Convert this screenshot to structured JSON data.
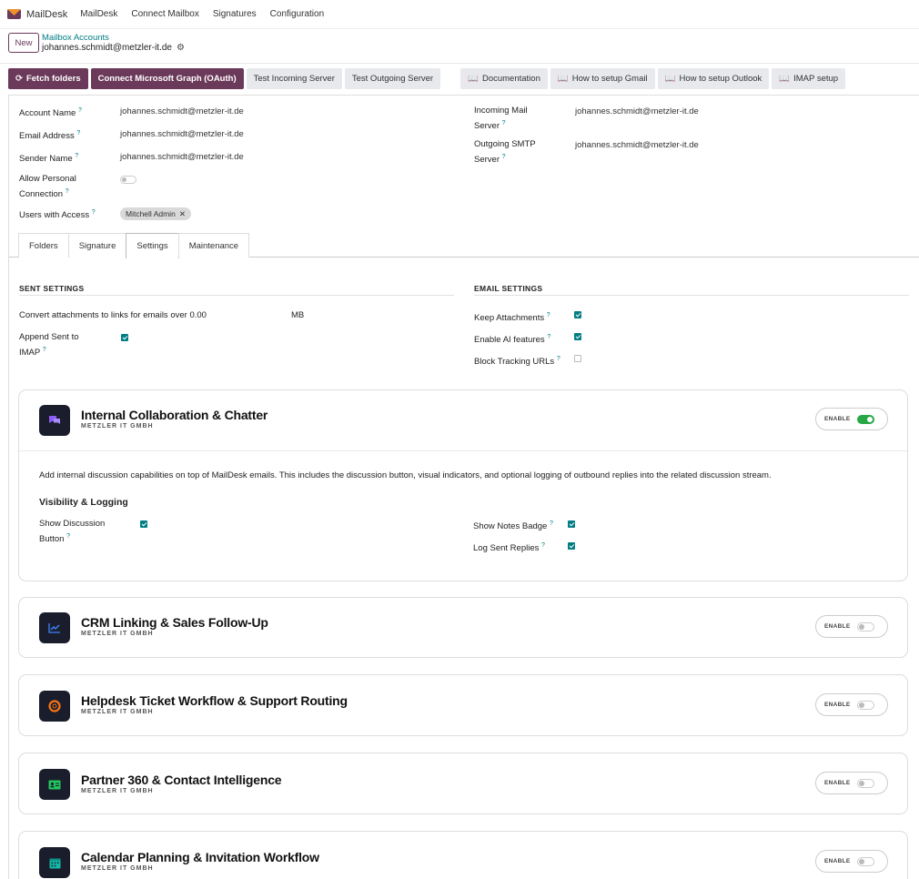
{
  "app": {
    "brand": "MailDesk",
    "accent": "#6b3a5a",
    "link_color": "#017e84"
  },
  "nav": [
    "MailDesk",
    "Connect Mailbox",
    "Signatures",
    "Configuration"
  ],
  "control": {
    "new_label": "New",
    "breadcrumb_parent": "Mailbox Accounts",
    "record_name": "johannes.schmidt@metzler-it.de"
  },
  "buttons": {
    "fetch": "Fetch folders",
    "connect_graph": "Connect Microsoft Graph (OAuth)",
    "test_incoming": "Test Incoming Server",
    "test_outgoing": "Test Outgoing Server",
    "documentation": "Documentation",
    "setup_gmail": "How to setup Gmail",
    "setup_outlook": "How to setup Outlook",
    "imap_setup": "IMAP setup"
  },
  "form": {
    "account_name": {
      "label": "Account Name",
      "value": "johannes.schmidt@metzler-it.de"
    },
    "email_address": {
      "label": "Email Address",
      "value": "johannes.schmidt@metzler-it.de"
    },
    "sender_name": {
      "label": "Sender Name",
      "value": "johannes.schmidt@metzler-it.de"
    },
    "allow_personal": {
      "label_1": "Allow Personal",
      "label_2": "Connection",
      "value": false
    },
    "users_access": {
      "label": "Users with Access",
      "tags": [
        "Mitchell Admin"
      ]
    },
    "incoming": {
      "label_1": "Incoming Mail",
      "label_2": "Server",
      "value": "johannes.schmidt@metzler-it.de"
    },
    "outgoing": {
      "label_1": "Outgoing SMTP",
      "label_2": "Server",
      "value": "johannes.schmidt@metzler-it.de"
    }
  },
  "tabs": [
    "Folders",
    "Signature",
    "Settings",
    "Maintenance"
  ],
  "active_tab": "Settings",
  "sent_settings": {
    "title": "SENT SETTINGS",
    "convert_label": "Convert attachments to links for emails over",
    "convert_value": "0.00",
    "convert_unit": "MB",
    "append_label_1": "Append Sent to",
    "append_label_2": "IMAP",
    "append_value": true
  },
  "email_settings": {
    "title": "EMAIL SETTINGS",
    "keep_attachments": {
      "label": "Keep Attachments",
      "value": true
    },
    "enable_ai": {
      "label": "Enable AI features",
      "value": true
    },
    "block_tracking": {
      "label": "Block Tracking URLs",
      "value": false
    }
  },
  "modules": [
    {
      "title": "Internal Collaboration & Chatter",
      "subtitle": "METZLER IT GMBH",
      "enable_label": "ENABLE",
      "enabled": true,
      "icon": "chat-icon",
      "icon_color": "#8b5cf6",
      "description": "Add internal discussion capabilities on top of MailDesk emails. This includes the discussion button, visual indicators, and optional logging of outbound replies into the related discussion stream.",
      "group_title": "Visibility & Logging",
      "show_discussion": {
        "label_1": "Show Discussion",
        "label_2": "Button",
        "value": true
      },
      "show_notes_badge": {
        "label": "Show Notes Badge",
        "value": true
      },
      "log_sent_replies": {
        "label": "Log Sent Replies",
        "value": true
      }
    },
    {
      "title": "CRM Linking & Sales Follow-Up",
      "subtitle": "METZLER IT GMBH",
      "enable_label": "ENABLE",
      "enabled": false,
      "icon": "chart-line-icon",
      "icon_color": "#3b82f6"
    },
    {
      "title": "Helpdesk Ticket Workflow & Support Routing",
      "subtitle": "METZLER IT GMBH",
      "enable_label": "ENABLE",
      "enabled": false,
      "icon": "lifebuoy-icon",
      "icon_color": "#f97316"
    },
    {
      "title": "Partner 360 & Contact Intelligence",
      "subtitle": "METZLER IT GMBH",
      "enable_label": "ENABLE",
      "enabled": false,
      "icon": "contact-card-icon",
      "icon_color": "#22c55e"
    },
    {
      "title": "Calendar Planning & Invitation Workflow",
      "subtitle": "METZLER IT GMBH",
      "enable_label": "ENABLE",
      "enabled": false,
      "icon": "calendar-icon",
      "icon_color": "#14b8a6"
    }
  ]
}
